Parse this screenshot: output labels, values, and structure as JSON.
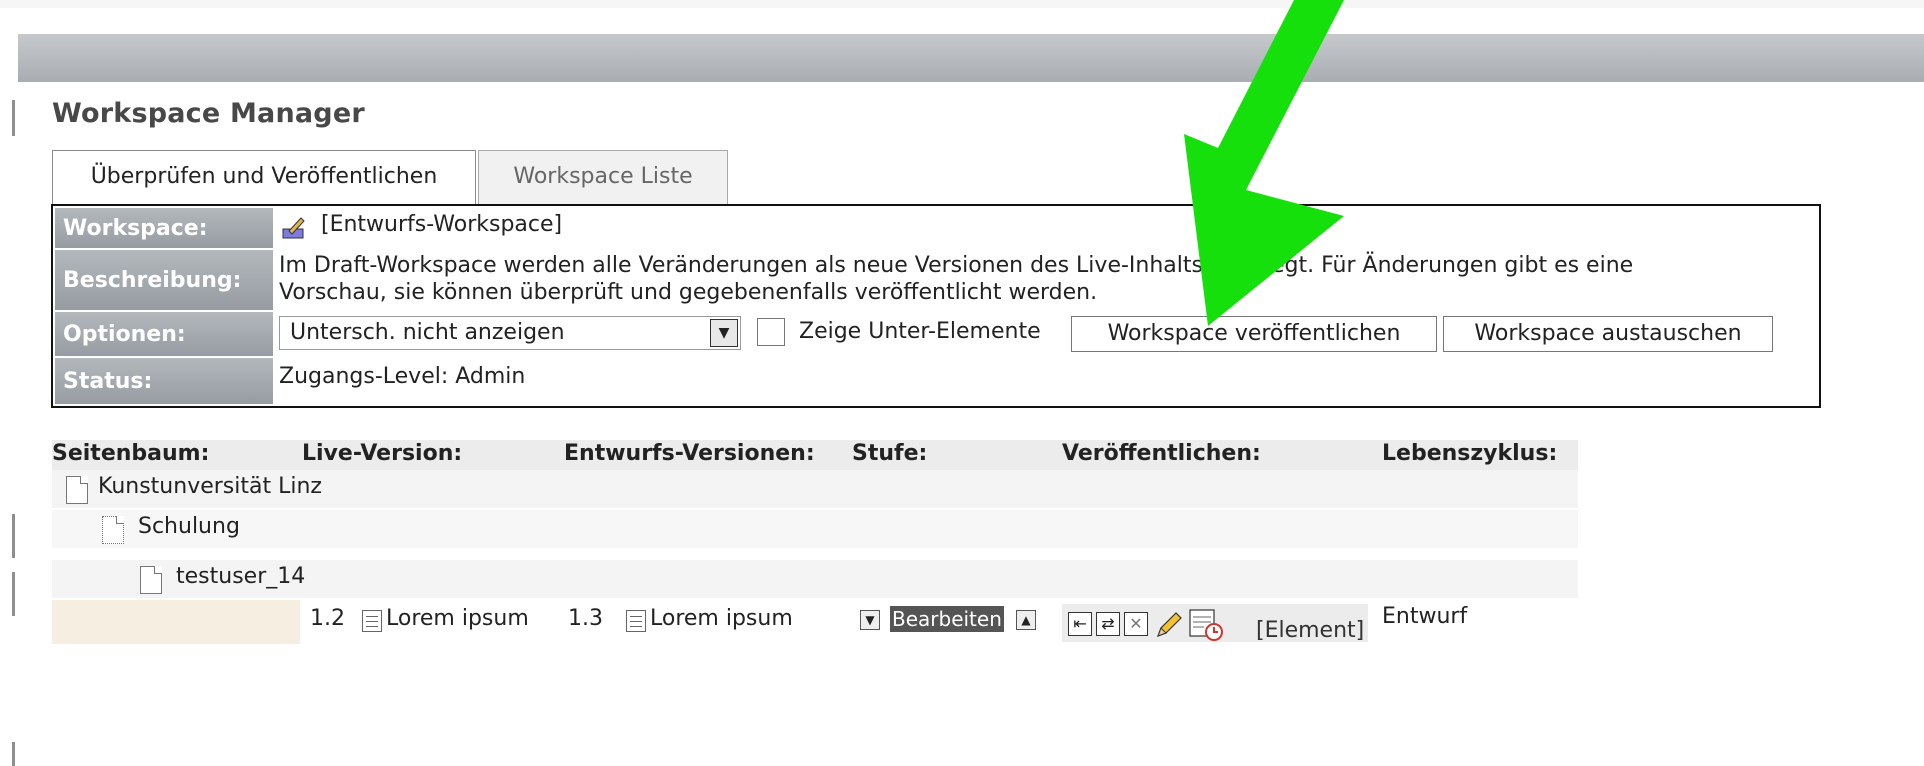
{
  "app": {
    "title": "Workspace Manager"
  },
  "tabs": [
    {
      "label": "Überprüfen und Veröffentlichen",
      "active": true
    },
    {
      "label": "Workspace Liste",
      "active": false
    }
  ],
  "info": {
    "workspace_label": "Workspace:",
    "workspace_value": "[Entwurfs-Workspace]",
    "description_label": "Beschreibung:",
    "description_line1": "Im Draft-Workspace werden alle Veränderungen als neue Versionen des Live-Inhalts angelegt. Für Änderungen gibt es eine",
    "description_line2": "Vorschau, sie können überprüft und gegebenenfalls veröffentlicht werden.",
    "options_label": "Optionen:",
    "select_value": "Untersch. nicht anzeigen",
    "checkbox_label": "Zeige Unter-Elemente",
    "checkbox_checked": false,
    "publish_button": "Workspace veröffentlichen",
    "swap_button": "Workspace austauschen",
    "status_label": "Status:",
    "status_value": "Zugangs-Level: Admin"
  },
  "table": {
    "columns": [
      "Seitenbaum:",
      "Live-Version:",
      "Entwurfs-Versionen:",
      "Stufe:",
      "Veröffentlichen:",
      "Lebenszyklus:"
    ],
    "tree": [
      {
        "label": "Kunstunversität Linz"
      },
      {
        "label": "Schulung"
      },
      {
        "label": "testuser_14"
      }
    ],
    "version_row": {
      "live_version": "1.2",
      "live_title": "Lorem ipsum",
      "draft_version": "1.3",
      "draft_title": "Lorem ipsum",
      "stage": "Bearbeiten",
      "element_link": "[Element]",
      "lifecycle": "Entwurf"
    }
  },
  "overlay": {
    "arrow_color": "#16e00b"
  }
}
